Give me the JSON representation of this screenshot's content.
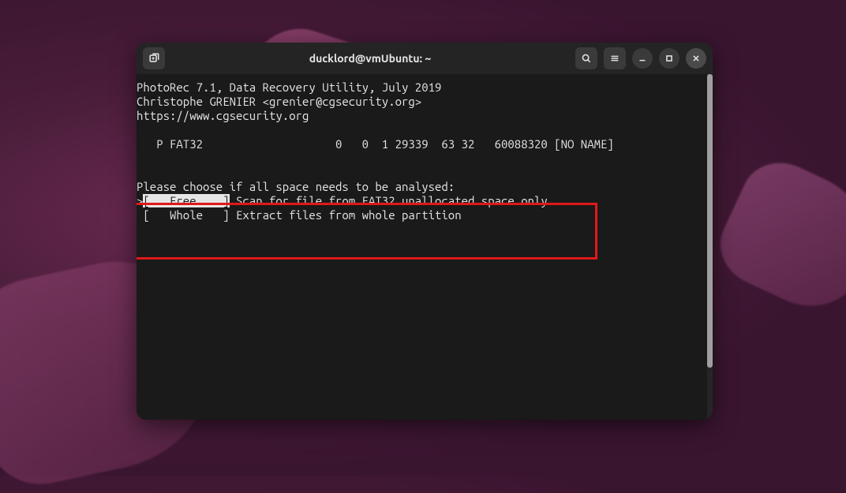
{
  "window": {
    "title": "ducklord@vmUbuntu: ~"
  },
  "term": {
    "line1": "PhotoRec 7.1, Data Recovery Utility, July 2019",
    "line2": "Christophe GRENIER <grenier@cgsecurity.org>",
    "line3": "https://www.cgsecurity.org",
    "partition": "   P FAT32                    0   0  1 29339  63 32   60088320 [NO NAME]",
    "prompt": "Please choose if all space needs to be analysed:",
    "opt_free_marker": ">",
    "opt_free_label": "[   Free    ]",
    "opt_free_desc": " Scan for file from FAT32 unallocated space only",
    "opt_whole": " [   Whole   ] Extract files from whole partition"
  }
}
